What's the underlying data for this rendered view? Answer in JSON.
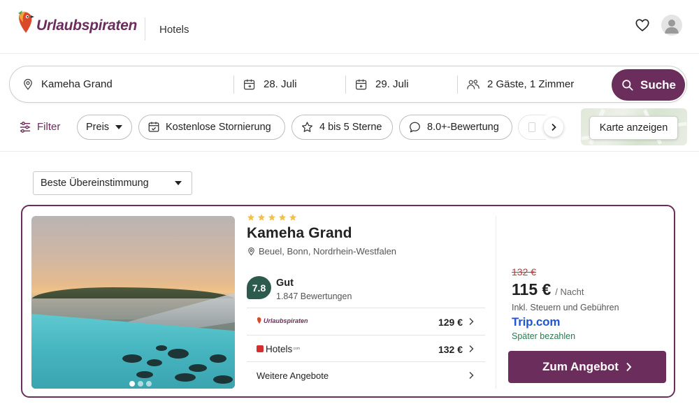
{
  "header": {
    "brand": "Urlaubspiraten",
    "nav_label": "Hotels"
  },
  "search": {
    "destination": "Kameha Grand",
    "checkin": "28. Juli",
    "checkout": "29. Juli",
    "guests": "2 Gäste, 1 Zimmer",
    "button_label": "Suche"
  },
  "filters": {
    "filter_label": "Filter",
    "chips": [
      "Preis",
      "Kostenlose Stornierung",
      "4 bis 5 Sterne",
      "8.0+-Bewertung"
    ],
    "map_button": "Karte anzeigen"
  },
  "sort": {
    "selected": "Beste Übereinstimmung"
  },
  "hotel": {
    "stars": 5,
    "name": "Kameha Grand",
    "location": "Beuel, Bonn, Nordrhein-Westfalen",
    "rating_score": "7.8",
    "rating_label": "Gut",
    "rating_count": "1.847 Bewertungen",
    "photo_index": 1,
    "photo_count": 3,
    "offers": [
      {
        "provider": "Urlaubspiraten",
        "price": "129 €"
      },
      {
        "provider": "Hotels",
        "provider_suffix": ".com",
        "price": "132 €"
      }
    ],
    "more_offers": "Weitere Angebote",
    "old_price": "132 €",
    "price": "115 €",
    "price_unit": "/ Nacht",
    "tax_note": "Inkl. Steuern und Gebühren",
    "partner_part1": "Trip",
    "partner_dot": ".",
    "partner_part2": "com",
    "pay_later": "Später bezahlen",
    "cta_label": "Zum Angebot"
  },
  "colors": {
    "brand": "#6b2d5c",
    "rating": "#2c5a4c",
    "star": "#f0c24b",
    "strike": "#c13a32"
  }
}
